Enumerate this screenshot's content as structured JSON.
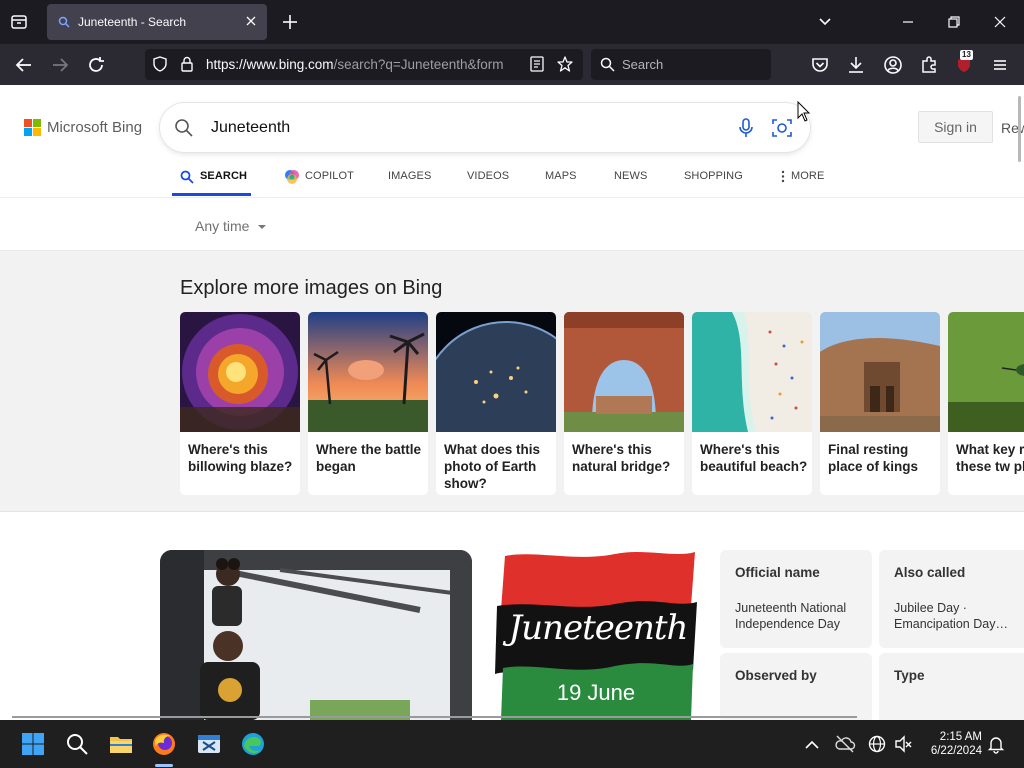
{
  "browser": {
    "tab_title": "Juneteenth - Search",
    "url_host": "https://www.bing.com",
    "url_rest": "/search?q=Juneteenth&form",
    "search_placeholder": "Search",
    "extension_badge": "13"
  },
  "bing": {
    "logo_text": "Microsoft Bing",
    "query": "Juneteenth",
    "sign_in": "Sign in",
    "rewards": "Rew",
    "tabs": [
      {
        "label": "SEARCH"
      },
      {
        "label": "COPILOT"
      },
      {
        "label": "IMAGES"
      },
      {
        "label": "VIDEOS"
      },
      {
        "label": "MAPS"
      },
      {
        "label": "NEWS"
      },
      {
        "label": "SHOPPING"
      },
      {
        "label": "MORE"
      }
    ],
    "time_filter": "Any time"
  },
  "explore": {
    "title": "Explore more images on Bing",
    "cards": [
      {
        "caption": "Where's this billowing blaze?",
        "icon": "fire-fractal-image"
      },
      {
        "caption": "Where the battle began",
        "icon": "palm-sunset-image"
      },
      {
        "caption": "What does this photo of Earth show?",
        "icon": "earth-night-image"
      },
      {
        "caption": "Where's this natural bridge?",
        "icon": "rock-arch-image"
      },
      {
        "caption": "Where's this beautiful beach?",
        "icon": "aerial-beach-image"
      },
      {
        "caption": "Final resting place of kings",
        "icon": "rock-tombs-image"
      },
      {
        "caption": "What key r do these tw play?",
        "icon": "hummingbird-image"
      }
    ]
  },
  "answer": {
    "banner_text": "Juneteenth",
    "banner_date": "19 June",
    "facts": [
      {
        "label": "Official name",
        "value": "Juneteenth National Independence Day"
      },
      {
        "label": "Also called",
        "value": "Jubilee Day · Emancipation Day…"
      },
      {
        "label": "Observed by",
        "value": ""
      },
      {
        "label": "Type",
        "value": ""
      }
    ]
  },
  "taskbar": {
    "time": "2:15 AM",
    "date": "6/22/2024"
  },
  "colors": {
    "bing_blue": "#174ae4",
    "firefox_dark": "#1c1b22",
    "toolbar": "#2b2a33"
  }
}
